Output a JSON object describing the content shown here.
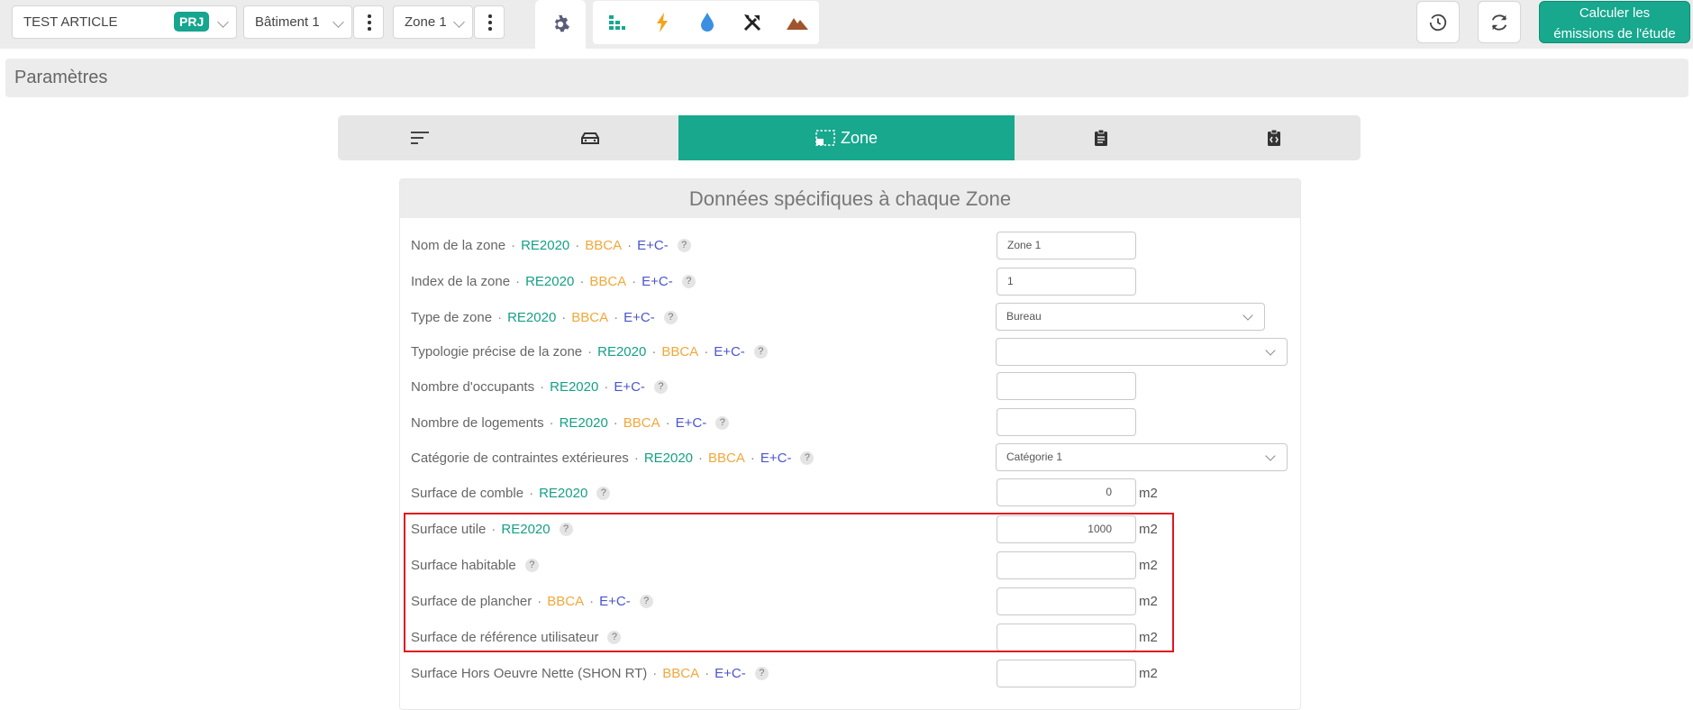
{
  "topbar": {
    "project": {
      "name": "TEST ARTICLE",
      "badge": "PRJ"
    },
    "building": "Bâtiment 1",
    "zone": "Zone 1",
    "tools": [
      "gear-icon",
      "building-blocks-icon",
      "lightning-icon",
      "water-drop-icon",
      "tools-icon",
      "mountain-icon"
    ],
    "calculate_label": "Calculer les émissions de l'étude"
  },
  "section_title": "Paramètres",
  "tabs": [
    {
      "icon": "sort-lines-icon",
      "label": ""
    },
    {
      "icon": "car-icon",
      "label": ""
    },
    {
      "icon": "zone-select-icon",
      "label": "Zone",
      "active": true
    },
    {
      "icon": "clipboard-icon",
      "label": ""
    },
    {
      "icon": "code-clipboard-icon",
      "label": ""
    }
  ],
  "panel_title": "Données spécifiques à chaque Zone",
  "tags": {
    "re": "RE2020",
    "bb": "BBCA",
    "ec": "E+C-",
    "sep": "·",
    "help": "?"
  },
  "colors": {
    "accent": "#17a88e",
    "re2020": "#15a087",
    "bbca": "#f0a83a",
    "ec": "#4b54cf",
    "highlight": "#e0161e"
  },
  "fields": [
    {
      "label": "Nom de la zone",
      "value": "Zone 1",
      "unit": ""
    },
    {
      "label": "Index de la zone",
      "value": "1",
      "unit": ""
    },
    {
      "label": "Type de zone",
      "value": "Bureau",
      "unit": ""
    },
    {
      "label": "Typologie précise de la zone",
      "value": "",
      "unit": ""
    },
    {
      "label": "Nombre d'occupants",
      "value": "",
      "unit": ""
    },
    {
      "label": "Nombre de logements",
      "value": "",
      "unit": ""
    },
    {
      "label": "Catégorie de contraintes extérieures",
      "value": "Catégorie 1",
      "unit": ""
    },
    {
      "label": "Surface de comble",
      "value": "0",
      "unit": "m2"
    },
    {
      "label": "Surface utile",
      "value": "1000",
      "unit": "m2"
    },
    {
      "label": "Surface habitable",
      "value": "",
      "unit": "m2"
    },
    {
      "label": "Surface de plancher",
      "value": "",
      "unit": "m2"
    },
    {
      "label": "Surface de référence utilisateur",
      "value": "",
      "unit": "m2"
    },
    {
      "label": "Surface Hors Oeuvre Nette (SHON RT)",
      "value": "",
      "unit": "m2"
    }
  ]
}
